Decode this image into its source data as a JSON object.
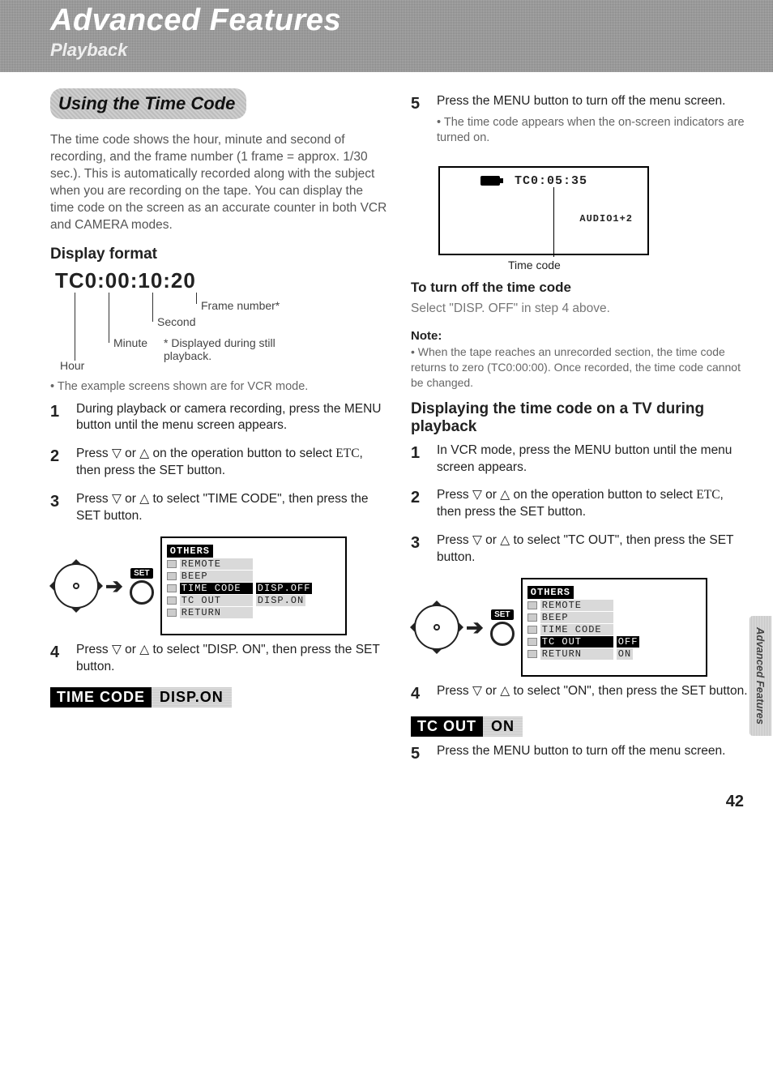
{
  "header": {
    "title": "Advanced Features",
    "subtitle": "Playback"
  },
  "side_tab": "Advanced Features",
  "page_number": "42",
  "section": {
    "tag": "Using the Time Code",
    "intro": "The time code shows the hour, minute and second of recording, and the frame number (1 frame = approx. 1/30 sec.). This is automatically recorded along with the subject when you are recording on the tape. You can display the time code on the screen as an accurate counter in both VCR and CAMERA modes.",
    "display_format_heading": "Display format",
    "tc_example": "TC0:00:10:20",
    "tc_labels": {
      "hour": "Hour",
      "minute": "Minute",
      "second": "Second",
      "frame": "Frame number*",
      "frame_note": "* Displayed during still playback."
    },
    "vcr_note": "• The example screens shown are for VCR mode.",
    "left": {
      "s1": "During playback or camera recording, press the MENU button until the menu screen appears.",
      "s2a": "Press ",
      "s2b": " or ",
      "s2c": " on the operation button to select ",
      "s2d": "ETC",
      "s2e": ", then press the SET button.",
      "s3a": "Press ",
      "s3b": " or ",
      "s3c": " to select \"TIME CODE\", then press the SET button.",
      "s4a": "Press ",
      "s4b": " or ",
      "s4c": " to select \"DISP. ON\", then press the SET button."
    },
    "osd1": {
      "header": "OTHERS",
      "rows": [
        {
          "k": "REMOTE",
          "v": ""
        },
        {
          "k": "BEEP",
          "v": ""
        },
        {
          "k": "TIME CODE",
          "v": "DISP.OFF",
          "hi": true
        },
        {
          "k": "TC OUT",
          "v": "DISP.ON"
        },
        {
          "k": "RETURN",
          "v": ""
        }
      ]
    },
    "bar1": {
      "a": "TIME CODE",
      "b": "DISP.ON"
    },
    "right": {
      "s5": "Press the MENU button to turn off the menu screen.",
      "s5b": "• The time code appears when the on-screen indicators are turned on.",
      "tc_small": "TC0:05:35",
      "audio": "AUDIO1+2",
      "tc_caption": "Time code",
      "turnoff_h": "To turn off the time code",
      "turnoff": "Select \"DISP. OFF\" in step 4 above.",
      "note_h": "Note:",
      "note": "• When the tape reaches an unrecorded section, the time code returns to zero (TC0:00:00). Once recorded, the time code cannot be changed.",
      "tv_h": "Displaying the time code on a TV during playback",
      "t1": "In VCR mode, press the MENU button until the menu screen appears.",
      "t2a": "Press ",
      "t2b": " or ",
      "t2c": " on the operation button to select ",
      "t2d": "ETC",
      "t2e": ", then press the SET button.",
      "t3a": "Press ",
      "t3b": " or ",
      "t3c": " to select \"TC OUT\", then press the SET button.",
      "t4a": "Press ",
      "t4b": " or ",
      "t4c": " to select \"ON\", then press the SET button.",
      "t5": "Press the MENU button to turn off the menu screen."
    },
    "osd2": {
      "header": "OTHERS",
      "rows": [
        {
          "k": "REMOTE",
          "v": ""
        },
        {
          "k": "BEEP",
          "v": ""
        },
        {
          "k": "TIME CODE",
          "v": ""
        },
        {
          "k": "TC OUT",
          "v": "OFF",
          "hi": true
        },
        {
          "k": "RETURN",
          "v": "ON"
        }
      ]
    },
    "bar2": {
      "a": "TC OUT",
      "b": "ON"
    }
  },
  "ui": {
    "set": "SET"
  }
}
